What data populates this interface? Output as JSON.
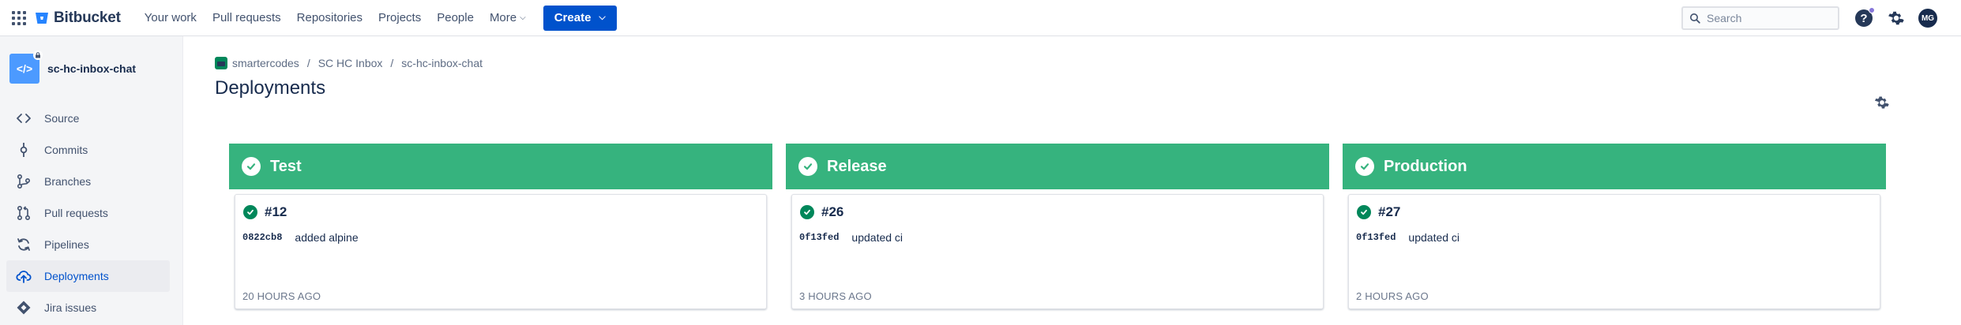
{
  "app": {
    "name": "Bitbucket",
    "brand_color": "#0052CC"
  },
  "nav": {
    "items": [
      {
        "label": "Your work"
      },
      {
        "label": "Pull requests"
      },
      {
        "label": "Repositories"
      },
      {
        "label": "Projects"
      },
      {
        "label": "People"
      },
      {
        "label": "More"
      }
    ],
    "create_label": "Create"
  },
  "search": {
    "placeholder": "Search"
  },
  "user": {
    "initials": "MG"
  },
  "sidebar": {
    "repo_name": "sc-hc-inbox-chat",
    "items": [
      {
        "label": "Source",
        "icon": "code-icon"
      },
      {
        "label": "Commits",
        "icon": "commit-icon"
      },
      {
        "label": "Branches",
        "icon": "branch-icon"
      },
      {
        "label": "Pull requests",
        "icon": "pull-request-icon"
      },
      {
        "label": "Pipelines",
        "icon": "pipelines-icon"
      },
      {
        "label": "Deployments",
        "icon": "deployments-icon",
        "active": true
      },
      {
        "label": "Jira issues",
        "icon": "jira-icon"
      }
    ]
  },
  "breadcrumb": {
    "workspace": "smartercodes",
    "project": "SC HC Inbox",
    "repo": "sc-hc-inbox-chat"
  },
  "page": {
    "title": "Deployments"
  },
  "environments": [
    {
      "name": "Test",
      "deploy_number": "#12",
      "hash": "0822cb8",
      "message": "added alpine",
      "time": "20 HOURS AGO"
    },
    {
      "name": "Release",
      "deploy_number": "#26",
      "hash": "0f13fed",
      "message": "updated ci",
      "time": "3 HOURS AGO"
    },
    {
      "name": "Production",
      "deploy_number": "#27",
      "hash": "0f13fed",
      "message": "updated ci",
      "time": "2 HOURS AGO"
    }
  ],
  "colors": {
    "success": "#36B37E",
    "success_dark": "#00875A",
    "active_nav": "#0052CC"
  }
}
